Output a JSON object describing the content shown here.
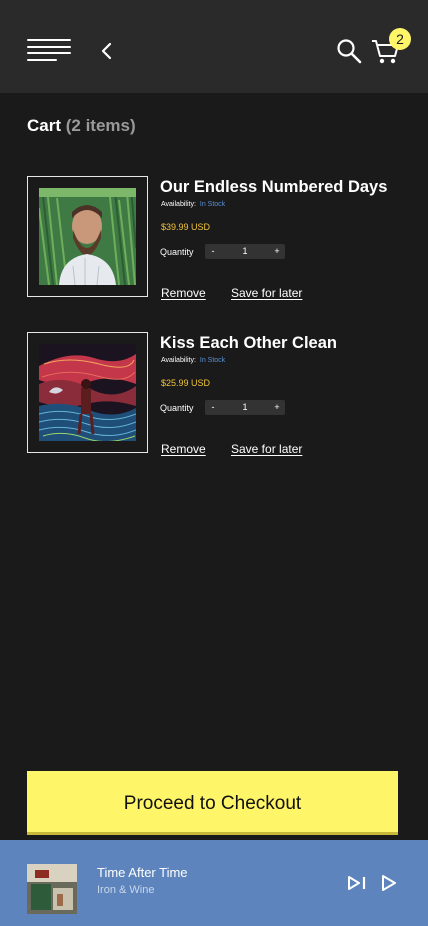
{
  "header": {
    "cart_badge": "2",
    "icons": [
      "menu-icon",
      "chevron-left-icon",
      "search-icon",
      "cart-icon"
    ]
  },
  "cart": {
    "title": "Cart",
    "count_text": "(2 items)",
    "items": [
      {
        "title": "Our Endless Numbered Days",
        "availability_label": "Availability:",
        "availability_value": "In Stock",
        "price": "$39.99 USD",
        "quantity_label": "Quantity",
        "minus": "-",
        "quantity": "1",
        "plus": "+",
        "remove_label": "Remove",
        "save_label": "Save for later"
      },
      {
        "title": "Kiss Each Other Clean",
        "availability_label": "Availability:",
        "availability_value": "In Stock",
        "price": "$25.99 USD",
        "quantity_label": "Quantity",
        "minus": "-",
        "quantity": "1",
        "plus": "+",
        "remove_label": "Remove",
        "save_label": "Save for later"
      }
    ]
  },
  "checkout": {
    "label": "Proceed to Checkout"
  },
  "player": {
    "track_title": "Time After Time",
    "artist": "Iron & Wine",
    "icons": [
      "skip-next-icon",
      "play-icon"
    ]
  },
  "colors": {
    "background": "#1a1a1a",
    "header": "#2a2a2a",
    "accent_yellow": "#fff568",
    "price": "#f2c43a",
    "in_stock": "#5b8fd6",
    "player_bar": "#5d84bc"
  }
}
